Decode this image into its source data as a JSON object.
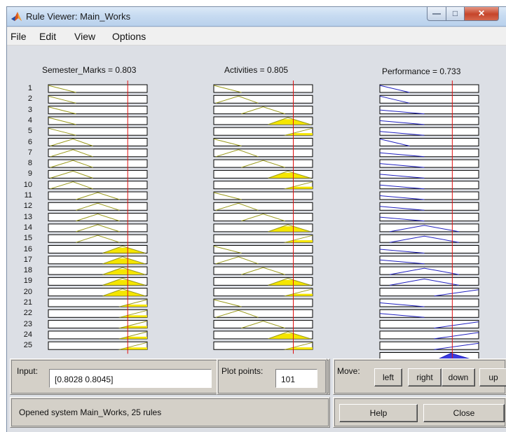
{
  "window": {
    "title": "Rule Viewer: Main_Works"
  },
  "menu": {
    "items": [
      "File",
      "Edit",
      "View",
      "Options"
    ]
  },
  "inputs": [
    {
      "label": "Semester_Marks = 0.803",
      "value": 0.803
    },
    {
      "label": "Activities = 0.805",
      "value": 0.805
    }
  ],
  "output": {
    "label": "Performance = 0.733",
    "value": 0.733
  },
  "rule_numbers": [
    "1",
    "2",
    "3",
    "4",
    "5",
    "6",
    "7",
    "8",
    "9",
    "10",
    "11",
    "12",
    "13",
    "14",
    "15",
    "16",
    "17",
    "18",
    "19",
    "20",
    "21",
    "22",
    "23",
    "24",
    "25"
  ],
  "rules": [
    {
      "sm": "low",
      "act": "low",
      "perf": "very_low"
    },
    {
      "sm": "low",
      "act": "medium",
      "perf": "very_low"
    },
    {
      "sm": "low",
      "act": "avg",
      "perf": "low"
    },
    {
      "sm": "low",
      "act": "good",
      "perf": "low"
    },
    {
      "sm": "low",
      "act": "high",
      "perf": "low"
    },
    {
      "sm": "medium",
      "act": "low",
      "perf": "very_low"
    },
    {
      "sm": "medium",
      "act": "medium",
      "perf": "low"
    },
    {
      "sm": "medium",
      "act": "avg",
      "perf": "low"
    },
    {
      "sm": "medium",
      "act": "good",
      "perf": "low"
    },
    {
      "sm": "medium",
      "act": "high",
      "perf": "low"
    },
    {
      "sm": "avg",
      "act": "low",
      "perf": "low"
    },
    {
      "sm": "avg",
      "act": "medium",
      "perf": "low"
    },
    {
      "sm": "avg",
      "act": "avg",
      "perf": "low"
    },
    {
      "sm": "avg",
      "act": "good",
      "perf": "medium"
    },
    {
      "sm": "avg",
      "act": "high",
      "perf": "medium"
    },
    {
      "sm": "good",
      "act": "low",
      "perf": "low"
    },
    {
      "sm": "good",
      "act": "medium",
      "perf": "low"
    },
    {
      "sm": "good",
      "act": "avg",
      "perf": "medium"
    },
    {
      "sm": "good",
      "act": "good",
      "perf": "medium"
    },
    {
      "sm": "good",
      "act": "high",
      "perf": "high"
    },
    {
      "sm": "high",
      "act": "low",
      "perf": "low"
    },
    {
      "sm": "high",
      "act": "medium",
      "perf": "low"
    },
    {
      "sm": "high",
      "act": "avg",
      "perf": "high"
    },
    {
      "sm": "high",
      "act": "good",
      "perf": "high"
    },
    {
      "sm": "high",
      "act": "high",
      "perf": "high"
    }
  ],
  "colors": {
    "input_mf_fill": "#f5e600",
    "input_mf_line": "#9a9a1a",
    "output_mf_line": "#1f1fbf",
    "aggregate_fill": "#3b3bdf",
    "crisp_line": "#e01010",
    "plot_bg": "#ffffff"
  },
  "controls": {
    "input_label": "Input:",
    "input_value": "[0.8028 0.8045]",
    "plot_points_label": "Plot points:",
    "plot_points_value": "101",
    "move_label": "Move:",
    "left_label": "left",
    "right_label": "right",
    "down_label": "down",
    "up_label": "up",
    "help_label": "Help",
    "close_label": "Close",
    "status_text": "Opened system Main_Works, 25 rules"
  },
  "icons": {
    "app": "matlab-logo-icon",
    "minimize": "minimize-icon",
    "maximize": "maximize-icon",
    "close": "close-icon"
  }
}
